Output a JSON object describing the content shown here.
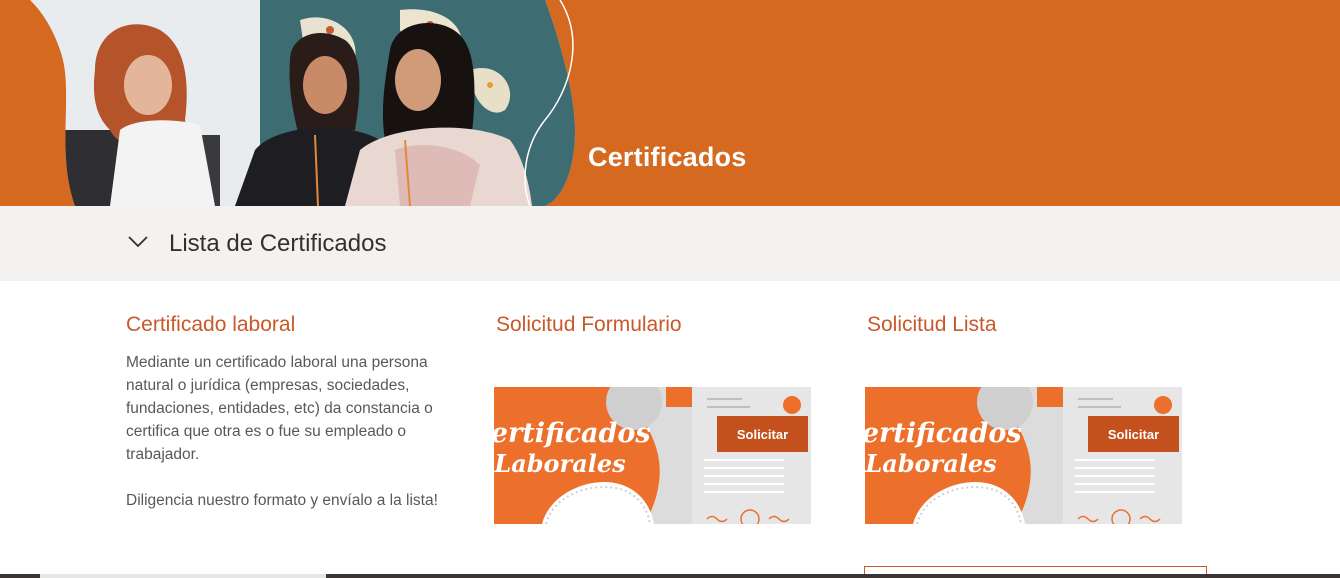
{
  "hero": {
    "title": "Certificados"
  },
  "section": {
    "title": "Lista de Certificados"
  },
  "columns": [
    {
      "title": "Certificado laboral",
      "paragraphs": [
        "Mediante un certificado laboral una persona natural o jurídica (empresas, sociedades, fundaciones, entidades, etc) da constancia o certifica que otra es o fue su empleado o trabajador.",
        "Diligencia nuestro formato y envíalo a la lista!"
      ]
    },
    {
      "title": "Solicitud Formulario",
      "card": {
        "line1": "Certificados",
        "line2": "Laborales",
        "button_label": "Solicitar"
      }
    },
    {
      "title": "Solicitud Lista",
      "card": {
        "line1": "Certificados",
        "line2": "Laborales",
        "button_label": "Solicitar"
      }
    }
  ],
  "colors": {
    "brand_orange": "#d4691f",
    "heading_orange": "#c9592a",
    "button": "#c4501d",
    "section_bg": "#f3f2f1"
  }
}
